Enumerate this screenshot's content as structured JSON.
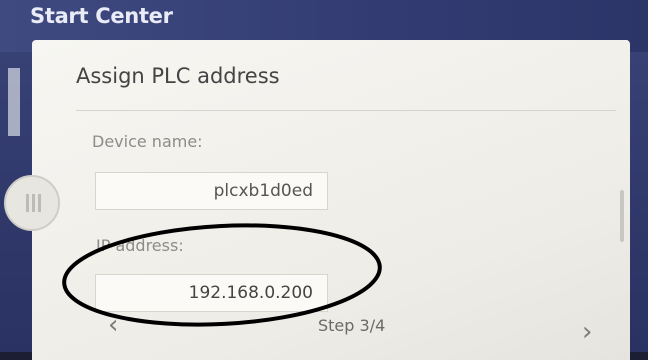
{
  "window": {
    "title": "Start Center"
  },
  "panel": {
    "title": "Assign PLC address"
  },
  "form": {
    "device_name_label": "Device name:",
    "device_name_value": "plcxb1d0ed",
    "ip_label": "IP address:",
    "ip_value": "192.168.0.200"
  },
  "nav": {
    "step_label": "Step 3/4",
    "prev_glyph": "‹",
    "next_glyph": "›"
  },
  "icons": {
    "minimize": "minimize-icon",
    "drag": "drag-handle-icon"
  },
  "colors": {
    "title_bar": "#3a4477",
    "panel": "#f4f3ef",
    "annotation": "#000000"
  }
}
